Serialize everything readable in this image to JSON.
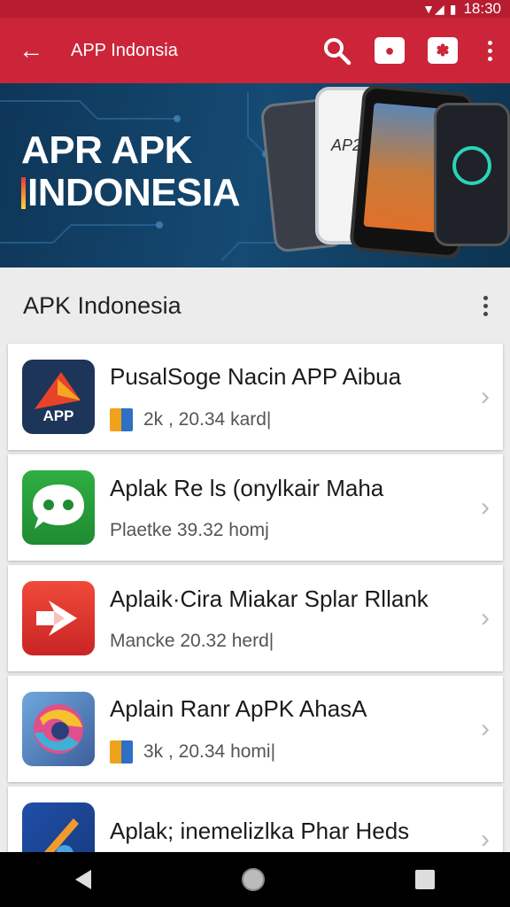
{
  "status_bar": {
    "time": "18:30"
  },
  "app_bar": {
    "title": "APP Indonsia"
  },
  "banner": {
    "title_line1": "APR APK",
    "title_line2": "NDONESIA",
    "title_initial": "I",
    "phone_text": "AP2"
  },
  "section": {
    "title": "APK Indonesia"
  },
  "apps": [
    {
      "name": "PusalSoge Nacin APP Aibua",
      "meta": "2k , 20.34 kard|",
      "icon": "app-logo-icon",
      "icon_label": "APP",
      "has_box": true
    },
    {
      "name": "Aplak Re ls (onylkair Maha",
      "meta": "Plaetke 39.32 homj",
      "icon": "chat-bubble-icon",
      "has_box": false
    },
    {
      "name": "Aplaik·Cira Miakar Splar Rllank",
      "meta": "Mancke 20.32 herd|",
      "icon": "arrow-share-icon",
      "has_box": false
    },
    {
      "name": "Aplain Ranr ApPK AhasA",
      "meta": "3k , 20.34 homi|",
      "icon": "swirl-logo-icon",
      "has_box": true
    },
    {
      "name": "Aplak; inemelizlka Phar Heds",
      "meta": "",
      "icon": "rocket-logo-icon",
      "has_box": false
    }
  ],
  "colors": {
    "app_bar": "#cc2539",
    "banner": "#154a73"
  }
}
